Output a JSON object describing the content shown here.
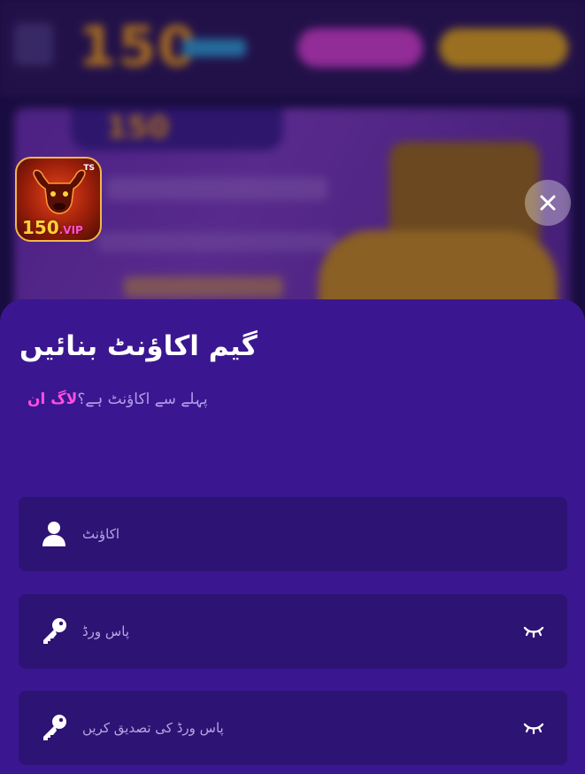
{
  "background": {
    "logo_text": "150",
    "banner_logo_text": "150"
  },
  "app_icon": {
    "badge_number": "150",
    "badge_suffix": ".VIP",
    "corner_text": "TS"
  },
  "close": {
    "icon": "close-icon"
  },
  "form": {
    "title": "گیم اکاؤنٹ بنائیں",
    "subtitle_text": "پہلے سے اکاؤنٹ ہے؟",
    "login_link": "لاگ ان",
    "fields": {
      "account": {
        "placeholder": "اکاؤنٹ",
        "icon": "user-icon"
      },
      "password": {
        "placeholder": "پاس ورڈ",
        "icon": "key-icon",
        "toggle_icon": "eye-closed-icon"
      },
      "confirm_password": {
        "placeholder": "پاس ورڈ کی تصدیق کریں",
        "icon": "key-icon",
        "toggle_icon": "eye-closed-icon"
      }
    }
  },
  "colors": {
    "sheet": "#3a1790",
    "field": "#2d1373",
    "accent_link": "#ff4fe1",
    "subtitle": "#b39dea"
  }
}
